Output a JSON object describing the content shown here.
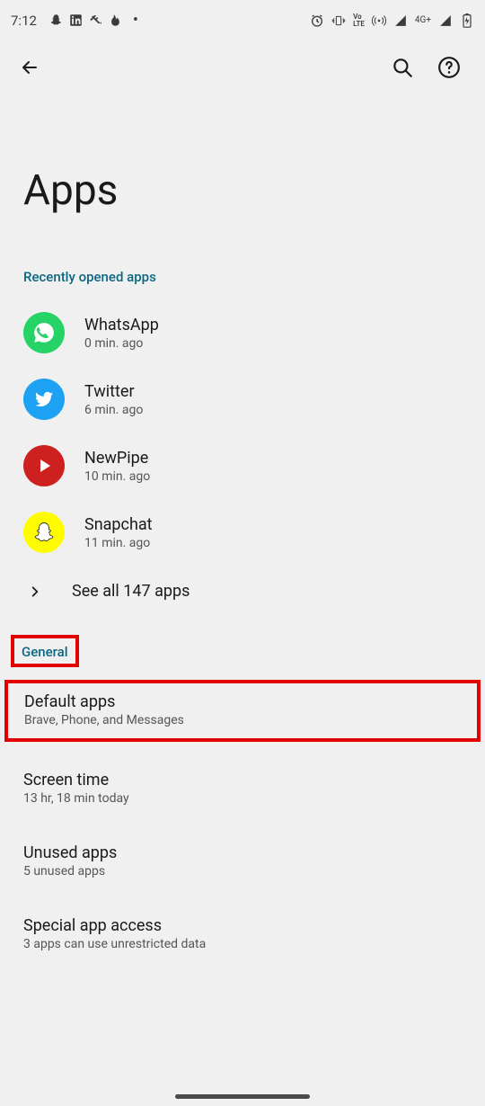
{
  "status": {
    "time": "7:12",
    "network_label": "4G+"
  },
  "page": {
    "title": "Apps"
  },
  "recent": {
    "label": "Recently opened apps",
    "apps": [
      {
        "name": "WhatsApp",
        "meta": "0 min. ago"
      },
      {
        "name": "Twitter",
        "meta": "6 min. ago"
      },
      {
        "name": "NewPipe",
        "meta": "10 min. ago"
      },
      {
        "name": "Snapchat",
        "meta": "11 min. ago"
      }
    ],
    "see_all": "See all 147 apps"
  },
  "general": {
    "label": "General",
    "items": {
      "default_apps": {
        "title": "Default apps",
        "subtitle": "Brave, Phone, and Messages"
      },
      "screen_time": {
        "title": "Screen time",
        "subtitle": "13 hr, 18 min today"
      },
      "unused_apps": {
        "title": "Unused apps",
        "subtitle": "5 unused apps"
      },
      "special_access": {
        "title": "Special app access",
        "subtitle": "3 apps can use unrestricted data"
      }
    }
  }
}
